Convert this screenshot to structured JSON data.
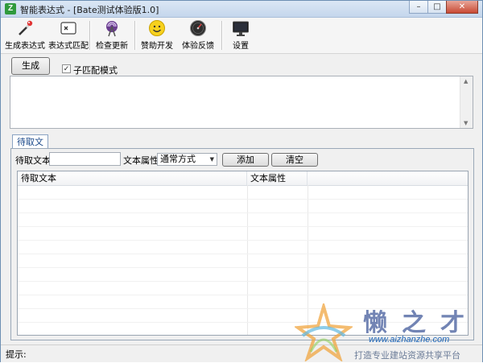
{
  "window": {
    "title": "智能表达式 - [Bate测试体验版1.0]",
    "app_icon_text": "Z",
    "minimize": "–",
    "maximize": "□",
    "close": "✕"
  },
  "toolbar": {
    "items": [
      {
        "label": "生成表达式",
        "icon": "magic-wand-icon"
      },
      {
        "label": "表达式匹配",
        "icon": "regex-match-icon"
      },
      {
        "label": "检查更新",
        "icon": "antenna-update-icon"
      },
      {
        "label": "赞助开发",
        "icon": "smiley-face-icon"
      },
      {
        "label": "体验反馈",
        "icon": "gauge-feedback-icon"
      },
      {
        "label": "设置",
        "icon": "monitor-settings-icon"
      }
    ]
  },
  "generate": {
    "button_label": "生成",
    "submatch_label": "子匹配模式",
    "submatch_checked": true,
    "submatch_check_glyph": "✓",
    "output_value": ""
  },
  "tabs": [
    {
      "label": "待取文本",
      "active": true
    }
  ],
  "panel": {
    "text_label": "待取文本:",
    "text_value": "",
    "attr_label": "文本属性:",
    "attr_selected": "通常方式",
    "add_label": "添加",
    "clear_label": "清空"
  },
  "list": {
    "columns": [
      "待取文本",
      "文本属性",
      ""
    ],
    "rows": []
  },
  "status": {
    "label": "提示:",
    "text": ""
  },
  "watermark": {
    "name": "懒之才",
    "url": "www.aizhanzhe.com",
    "tagline": "打造专业建站资源共享平台"
  },
  "colors": {
    "title_bar": "#c4d6ec",
    "close_button": "#c94a34",
    "tab_text": "#1c4a8a",
    "watermark_text": "#5a6fa8",
    "watermark_url": "#1e66b8"
  }
}
